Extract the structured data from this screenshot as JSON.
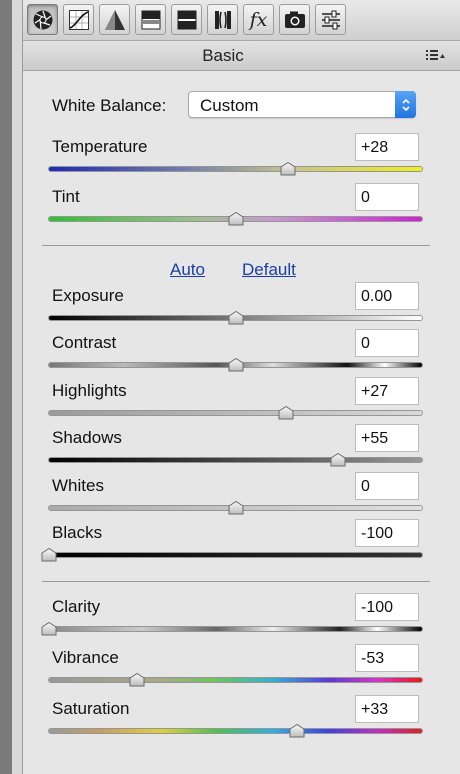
{
  "toolbar": {
    "icons": [
      "aperture-icon",
      "tone-curve-icon",
      "detail-icon",
      "hsl-icon",
      "split-toning-icon",
      "lens-corrections-icon",
      "fx-icon",
      "camera-calibration-icon",
      "presets-icon"
    ],
    "fx_label": "fx"
  },
  "panel": {
    "title": "Basic"
  },
  "white_balance": {
    "label": "White Balance:",
    "value": "Custom"
  },
  "auto_label": "Auto",
  "default_label": "Default",
  "sliders": [
    {
      "key": "temperature",
      "label": "Temperature",
      "value": "+28",
      "position": 0.64
    },
    {
      "key": "tint",
      "label": "Tint",
      "value": "0",
      "position": 0.5
    },
    {
      "key": "exposure",
      "label": "Exposure",
      "value": "0.00",
      "position": 0.5
    },
    {
      "key": "contrast",
      "label": "Contrast",
      "value": "0",
      "position": 0.5
    },
    {
      "key": "highlights",
      "label": "Highlights",
      "value": "+27",
      "position": 0.635
    },
    {
      "key": "shadows",
      "label": "Shadows",
      "value": "+55",
      "position": 0.775
    },
    {
      "key": "whites",
      "label": "Whites",
      "value": "0",
      "position": 0.5
    },
    {
      "key": "blacks",
      "label": "Blacks",
      "value": "-100",
      "position": 0.0
    },
    {
      "key": "clarity",
      "label": "Clarity",
      "value": "-100",
      "position": 0.0
    },
    {
      "key": "vibrance",
      "label": "Vibrance",
      "value": "-53",
      "position": 0.235
    },
    {
      "key": "saturation",
      "label": "Saturation",
      "value": "+33",
      "position": 0.665
    }
  ]
}
